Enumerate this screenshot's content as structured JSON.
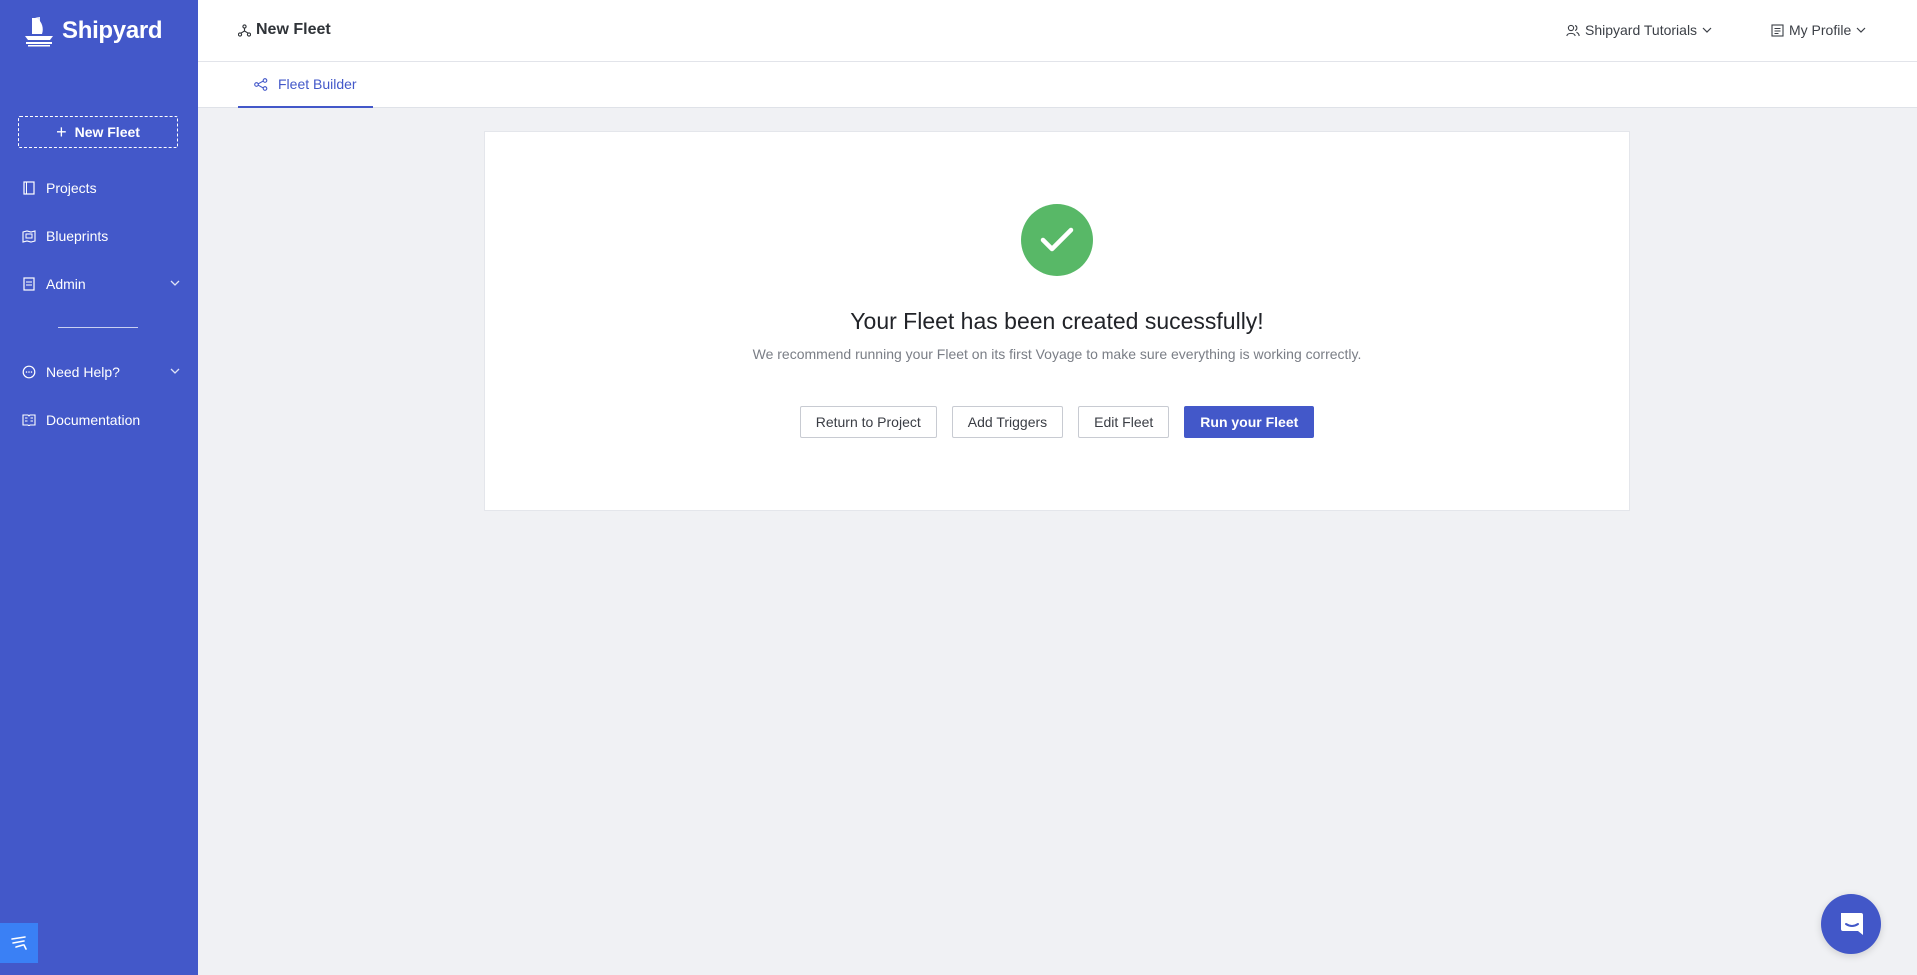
{
  "app": {
    "name": "Shipyard",
    "brand_color": "#4358c9"
  },
  "sidebar": {
    "new_fleet_label": "New Fleet",
    "items": [
      {
        "label": "Projects",
        "icon": "book-icon"
      },
      {
        "label": "Blueprints",
        "icon": "blueprint-icon"
      },
      {
        "label": "Admin",
        "icon": "admin-icon",
        "expandable": true
      },
      {
        "label": "Need Help?",
        "icon": "chat-bubble-icon",
        "expandable": true
      },
      {
        "label": "Documentation",
        "icon": "docs-icon"
      }
    ]
  },
  "header": {
    "title": "New Fleet",
    "org_menu": "Shipyard Tutorials",
    "profile_menu": "My Profile"
  },
  "tabs": [
    {
      "label": "Fleet Builder",
      "active": true
    }
  ],
  "main": {
    "success_title": "Your Fleet has been created sucessfully!",
    "success_subtitle": "We recommend running your Fleet on its first Voyage to make sure everything is working correctly.",
    "buttons": {
      "return": "Return to Project",
      "triggers": "Add Triggers",
      "edit": "Edit Fleet",
      "run": "Run your Fleet"
    }
  },
  "colors": {
    "success": "#58b867",
    "corner_button": "#3a80f5"
  }
}
